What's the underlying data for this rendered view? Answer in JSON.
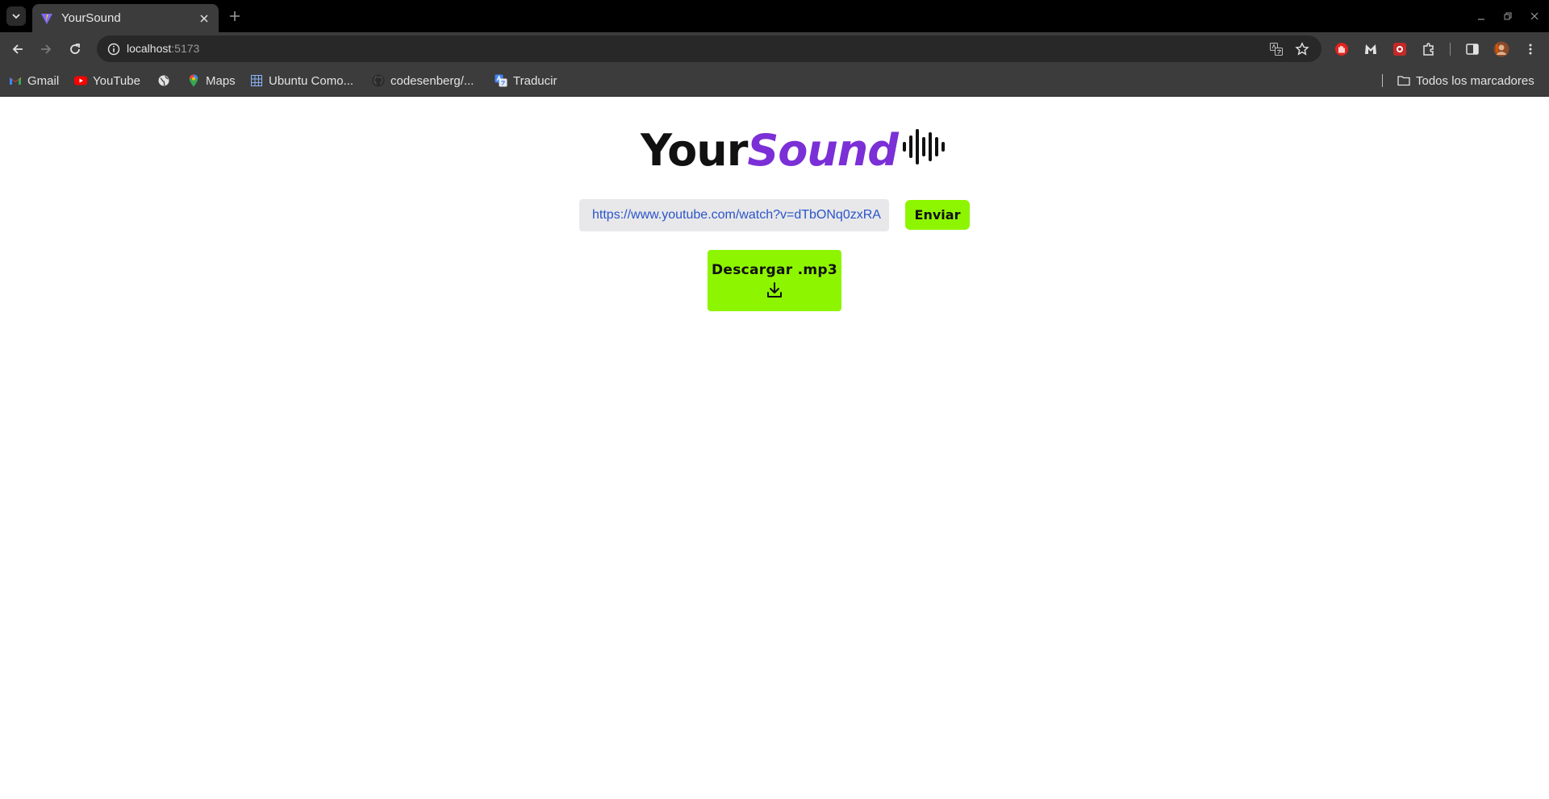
{
  "browser": {
    "tab": {
      "title": "YourSound"
    },
    "address": {
      "host": "localhost",
      "port": ":5173"
    },
    "bookmarks": [
      {
        "label": "Gmail",
        "icon": "gmail-icon"
      },
      {
        "label": "YouTube",
        "icon": "youtube-icon"
      },
      {
        "label": "",
        "icon": "globe-icon"
      },
      {
        "label": "Maps",
        "icon": "maps-icon"
      },
      {
        "label": "Ubuntu Como...",
        "icon": "sheets-icon"
      },
      {
        "label": "codesenberg/...",
        "icon": "github-icon"
      },
      {
        "label": "Traducir",
        "icon": "translate-icon"
      }
    ],
    "all_bookmarks_label": "Todos los marcadores"
  },
  "app": {
    "logo": {
      "part1": "Your",
      "part2": "Sound"
    },
    "url_field": {
      "value": "https://www.youtube.com/watch?v=dTbONq0zxRA"
    },
    "send_label": "Enviar",
    "download_label": "Descargar .mp3"
  },
  "colors": {
    "accent_green": "#8ef500",
    "logo_purple": "#7b2fd6",
    "url_text": "#2a54c9"
  }
}
